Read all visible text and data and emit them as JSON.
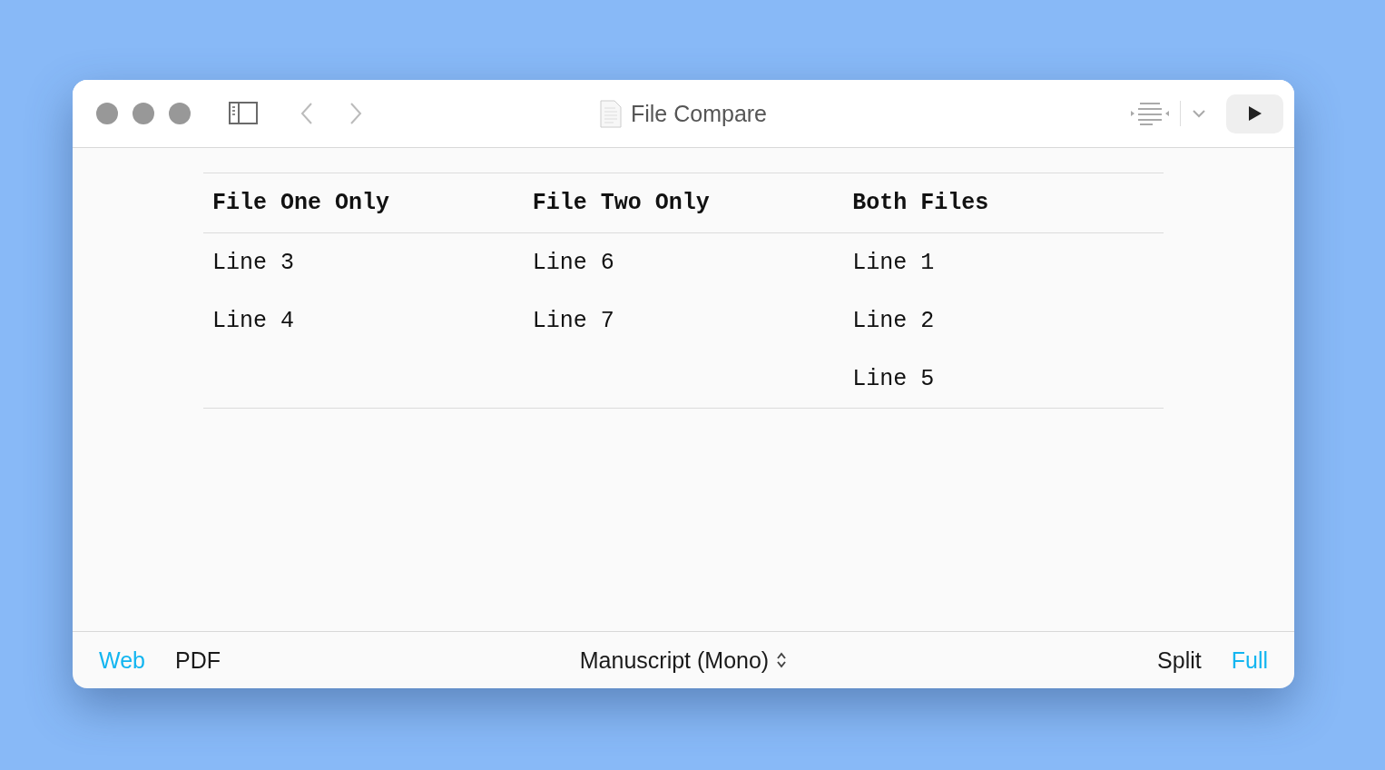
{
  "window": {
    "title": "File Compare"
  },
  "table": {
    "columns": [
      "File One Only",
      "File Two Only",
      "Both Files"
    ],
    "rows": [
      [
        "Line 3",
        "Line 6",
        "Line 1"
      ],
      [
        "Line 4",
        "Line 7",
        "Line 2"
      ],
      [
        "",
        "",
        "Line 5"
      ]
    ]
  },
  "footer": {
    "formats": [
      {
        "label": "Web",
        "selected": true
      },
      {
        "label": "PDF",
        "selected": false
      }
    ],
    "style": "Manuscript (Mono)",
    "modes": [
      {
        "label": "Split",
        "selected": false
      },
      {
        "label": "Full",
        "selected": true
      }
    ]
  }
}
